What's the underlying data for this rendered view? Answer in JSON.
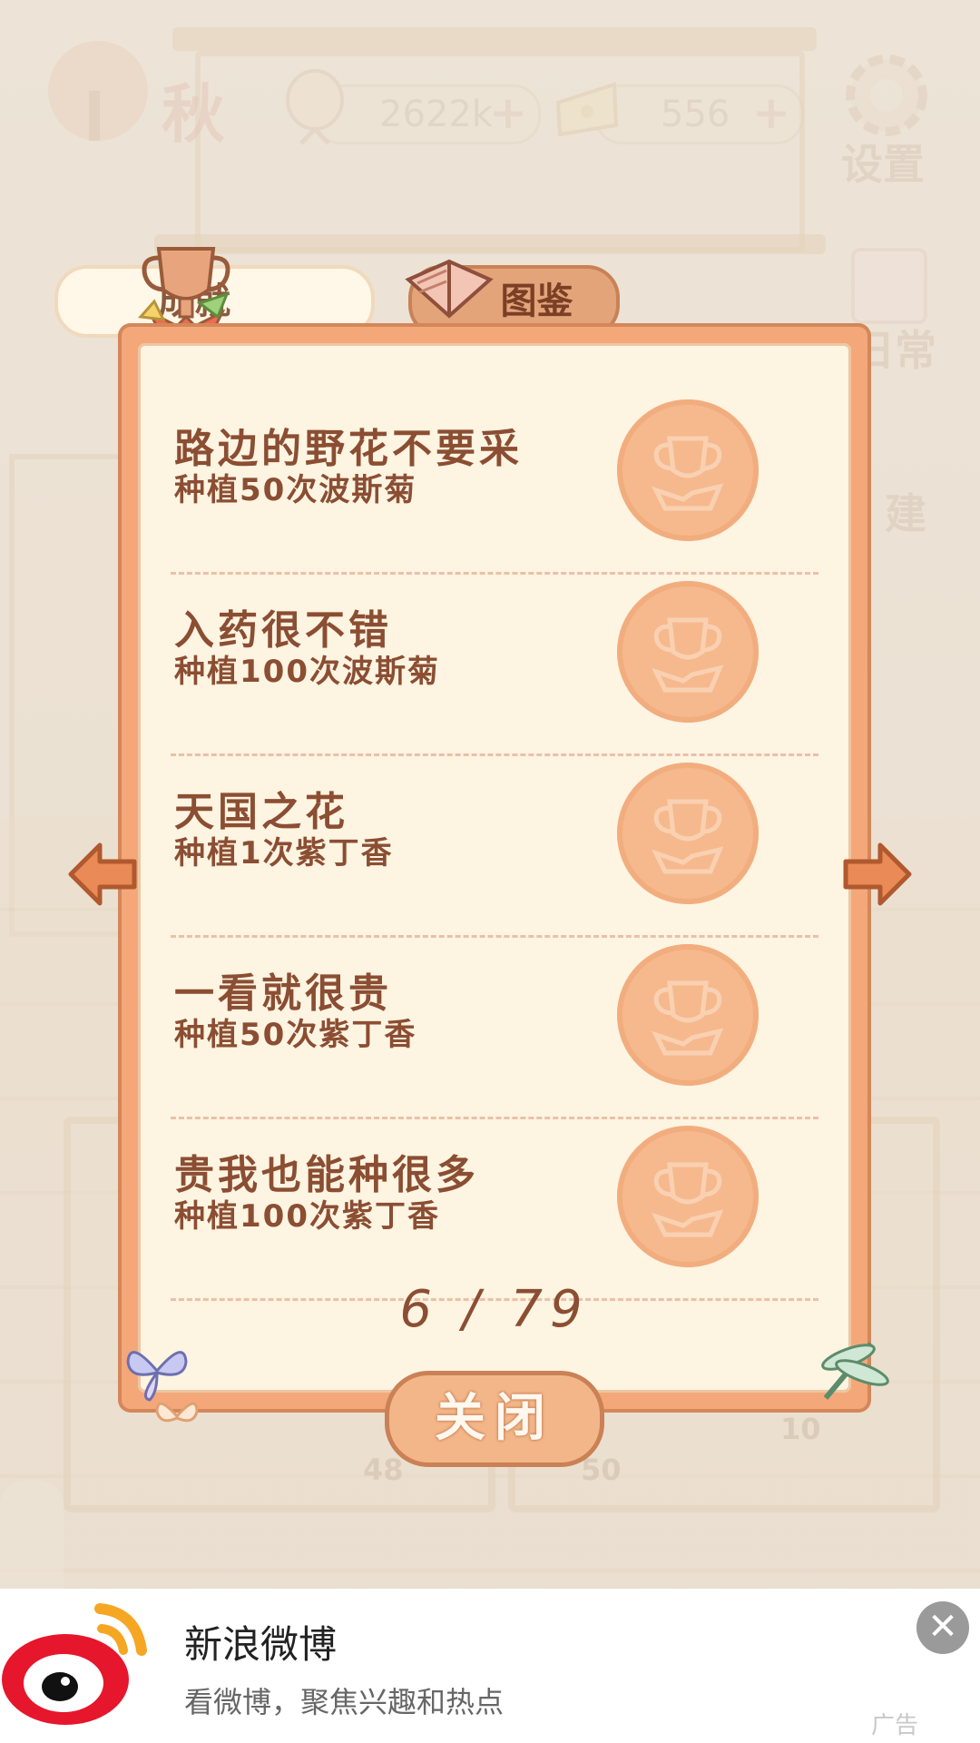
{
  "header": {
    "season": "秋",
    "fish_count": "2622k",
    "cheese_count": "556",
    "settings_label": "设置",
    "side_daily_label": "日常",
    "side_build_label": "建"
  },
  "tabs": [
    {
      "label": "成就",
      "active": true
    },
    {
      "label": "图鉴",
      "active": false
    }
  ],
  "achievements": [
    {
      "title": "路边的野花不要采",
      "desc": "种植50次波斯菊"
    },
    {
      "title": "入药很不错",
      "desc": "种植100次波斯菊"
    },
    {
      "title": "天国之花",
      "desc": "种植1次紫丁香"
    },
    {
      "title": "一看就很贵",
      "desc": "种植50次紫丁香"
    },
    {
      "title": "贵我也能种很多",
      "desc": "种植100次紫丁香"
    }
  ],
  "pagination": {
    "text": "6 / 79"
  },
  "close_label": "关闭",
  "background_numbers": {
    "left": "48",
    "middle": "50",
    "right": "10"
  },
  "ad": {
    "title": "新浪微博",
    "subtitle": "看微博，聚焦兴趣和热点",
    "tag": "广告"
  },
  "colors": {
    "panel_border": "#f4a879",
    "panel_fill": "#fdf4e1",
    "text_brown": "#8b4e33",
    "medal": "#f6b98d"
  }
}
